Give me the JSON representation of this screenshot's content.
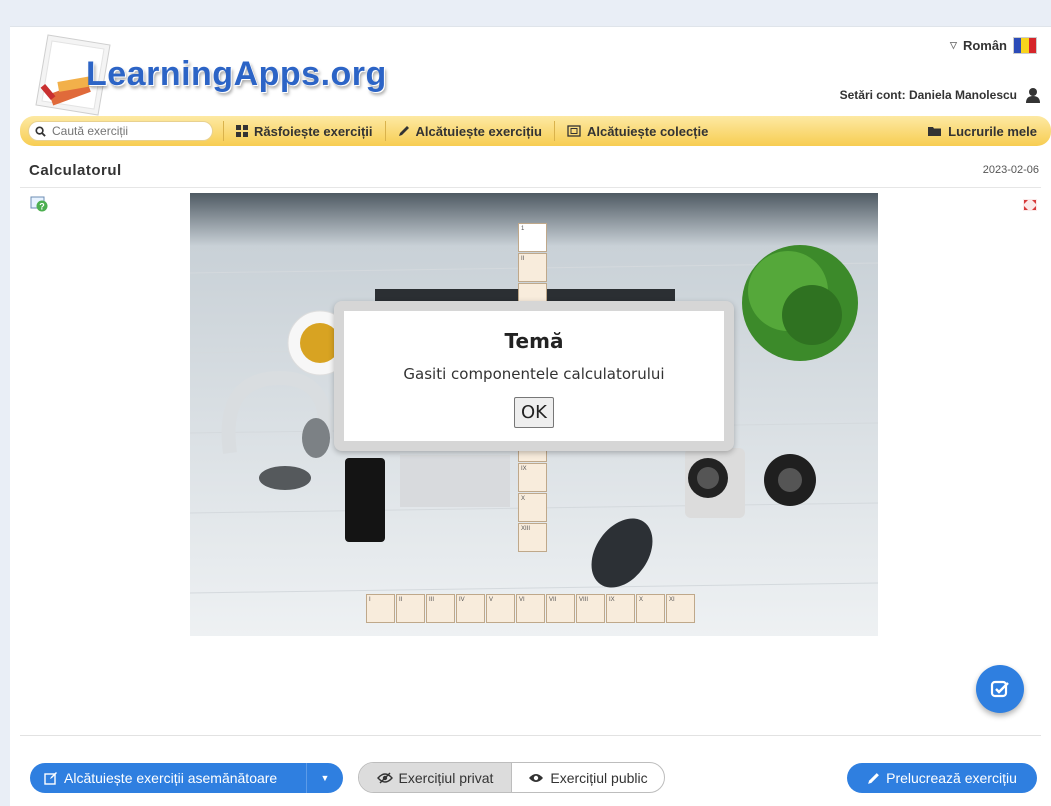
{
  "header": {
    "logo_text": "LearningApps.org",
    "language": "Român",
    "account_text": "Setări cont: Daniela Manolescu"
  },
  "nav": {
    "search_placeholder": "Caută exerciții",
    "browse": "Răsfoiește exerciții",
    "create_exercise": "Alcătuiește exercițiu",
    "create_collection": "Alcătuiește colecție",
    "my_works": "Lucrurile mele"
  },
  "exercise": {
    "title": "Calculatorul",
    "date": "2023-02-06"
  },
  "dialog": {
    "title": "Temă",
    "text": "Gasiti componentele calculatorului",
    "ok": "OK"
  },
  "vertical_cells": [
    "1",
    "II",
    "",
    "",
    "",
    "",
    "",
    "",
    "IX",
    "X",
    "XIII"
  ],
  "horizontal_cells": [
    "I",
    "II",
    "III",
    "IV",
    "V",
    "VI",
    "VII",
    "VIII",
    "IX",
    "X",
    "XI"
  ],
  "footer": {
    "similar": "Alcătuiește exerciții asemănătoare",
    "private": "Exercițiul privat",
    "public": "Exercițiul public",
    "edit": "Prelucrează exercițiu"
  },
  "colors": {
    "accent_blue": "#2f7fe0",
    "nav_yellow": "#f7cd52",
    "logo_blue": "#2c64c6"
  }
}
